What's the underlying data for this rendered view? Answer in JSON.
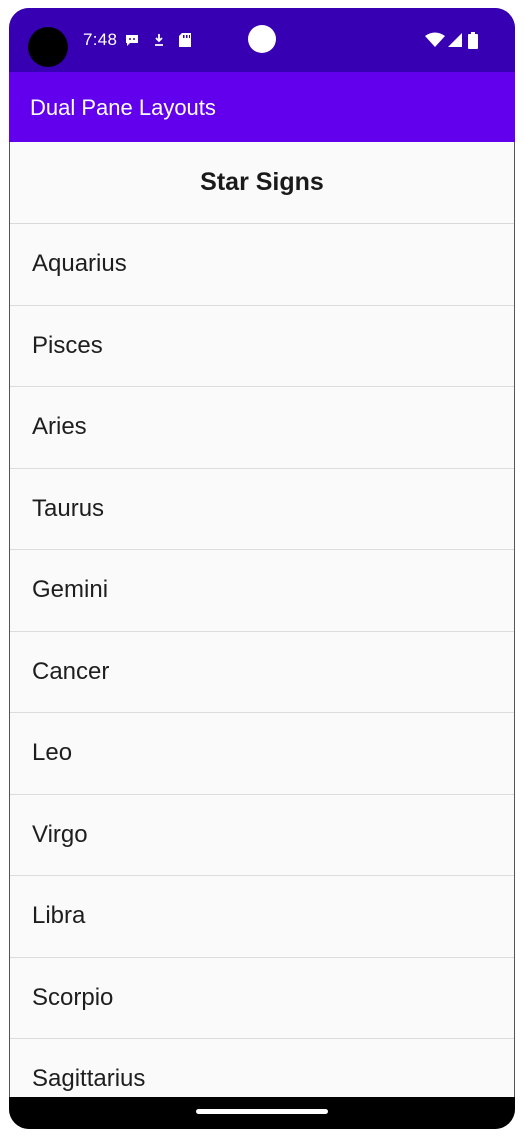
{
  "status_bar": {
    "time": "7:48",
    "icons": [
      "message-icon",
      "download-icon",
      "sd-card-icon",
      "wifi-icon",
      "signal-icon",
      "battery-icon"
    ]
  },
  "app_bar": {
    "title": "Dual Pane Layouts"
  },
  "list": {
    "header": "Star Signs",
    "items": [
      {
        "label": "Aquarius"
      },
      {
        "label": "Pisces"
      },
      {
        "label": "Aries"
      },
      {
        "label": "Taurus"
      },
      {
        "label": "Gemini"
      },
      {
        "label": "Cancer"
      },
      {
        "label": "Leo"
      },
      {
        "label": "Virgo"
      },
      {
        "label": "Libra"
      },
      {
        "label": "Scorpio"
      },
      {
        "label": "Sagittarius"
      }
    ]
  },
  "colors": {
    "status_bar": "#3700b3",
    "app_bar": "#6200ee",
    "background": "#fafafa"
  }
}
